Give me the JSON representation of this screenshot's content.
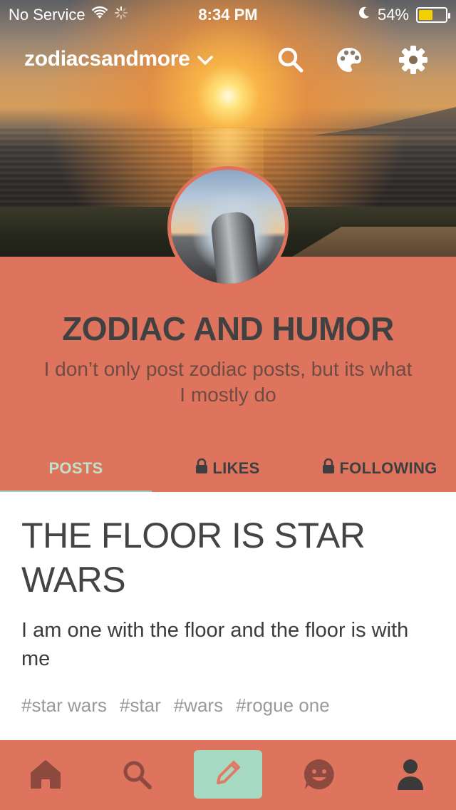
{
  "status_bar": {
    "carrier": "No Service",
    "time": "8:34 PM",
    "battery_percent": "54%",
    "battery_level": 0.54,
    "icons": [
      "wifi-icon",
      "loading-icon",
      "moon-icon",
      "battery-icon"
    ]
  },
  "navbar": {
    "blog_name": "zodiacsandmore",
    "icons": [
      "chevron-down-icon",
      "search-icon",
      "palette-icon",
      "gear-icon"
    ]
  },
  "profile": {
    "title": "ZODIAC AND HUMOR",
    "description": "I don’t only post zodiac posts, but its what I mostly do"
  },
  "tabs": [
    {
      "label": "POSTS",
      "locked": false,
      "active": true
    },
    {
      "label": "LIKES",
      "locked": true,
      "active": false
    },
    {
      "label": "FOLLOWING",
      "locked": true,
      "active": false
    }
  ],
  "post": {
    "title": "THE FLOOR IS STAR WARS",
    "body": "I am one with the floor and the floor is with me",
    "tags": [
      "#star wars",
      "#star",
      "#wars",
      "#rogue one"
    ]
  },
  "bottom_nav": {
    "items": [
      "home-icon",
      "search-icon",
      "pencil-icon",
      "smiley-chat-icon",
      "person-icon"
    ]
  },
  "colors": {
    "accent": "#df745e",
    "title_text": "#414142",
    "active_tab": "#bfe2c9",
    "compose_button": "#a6d9c1",
    "tag_text": "#9a9a9a",
    "battery_fill": "#f5d000"
  }
}
